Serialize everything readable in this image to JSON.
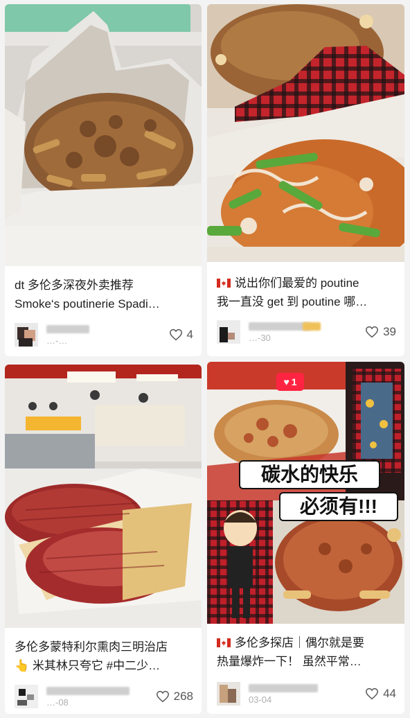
{
  "feed": {
    "cards": [
      {
        "title_line1": "dt 多伦多深夜外卖推荐",
        "title_line2": "Smoke‘s poutinerie Spadi…",
        "has_flag": false,
        "date": "…-…",
        "likes": "4"
      },
      {
        "title_line1": "说出你们最爱的 poutine",
        "title_line2": "我一直没 get 到 poutine 哪…",
        "has_flag": true,
        "date": "…-30",
        "likes": "39"
      },
      {
        "title_line1": "多伦多蒙特利尔熏肉三明治店",
        "title_line2": "👆 米其林只夸它 #中二少…",
        "has_flag": false,
        "date": "…-08",
        "likes": "268"
      },
      {
        "title_line1": "多伦多探店｜偶尔就是要",
        "title_line2": "热量爆炸一下！ 虽然平常…",
        "has_flag": true,
        "date": "03-04",
        "likes": "44",
        "overlay_line1": "碳水的快乐",
        "overlay_line2": "必须有!!!",
        "notification_count": "1"
      }
    ]
  },
  "colors": {
    "background": "#f3f3f3",
    "card": "#ffffff",
    "title_text": "#1e1e1e",
    "meta_text": "#b0b0b0",
    "canada_red": "#d52b1e",
    "badge_red": "#ff2442"
  },
  "icons": [
    "heart-outline-icon",
    "canada-flag-icon",
    "notification-heart-badge",
    "avatar"
  ]
}
